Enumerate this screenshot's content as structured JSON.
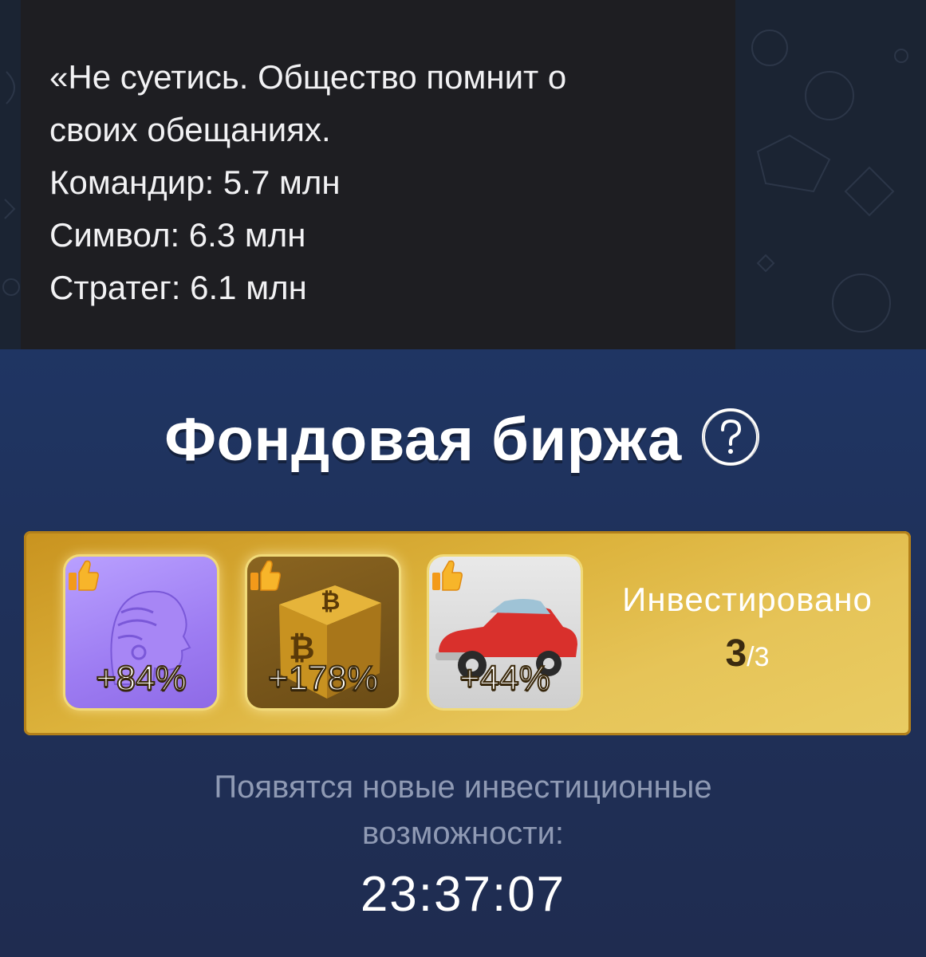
{
  "chat": {
    "message_lines": [
      "«Не суетись. Общество помнит о",
      "своих обещаниях.",
      "Командир: 5.7 млн",
      "Символ: 6.3 млн",
      "Стратег: 6.1 млн"
    ]
  },
  "exchange": {
    "title": "Фондовая биржа",
    "help_icon": "question-circle-icon",
    "cards": [
      {
        "name": "ai-head",
        "percent": "+84%",
        "icon": "thumbs-up-icon"
      },
      {
        "name": "bitcoin-cube",
        "percent": "+178%",
        "icon": "thumbs-up-icon"
      },
      {
        "name": "retro-car",
        "percent": "+44%",
        "icon": "thumbs-up-icon"
      }
    ],
    "invested_label": "Инвестировано",
    "invested_count": "3",
    "invested_total": "/3",
    "notice": "Появятся новые инвестиционные возможности:",
    "timer": "23:37:07"
  },
  "colors": {
    "chat_bg": "#1b2433",
    "bubble_bg": "#1e1e22",
    "app_bg": "#1f3058",
    "gold_panel": "#dcb23b",
    "notice_text": "#8f9ab4"
  }
}
